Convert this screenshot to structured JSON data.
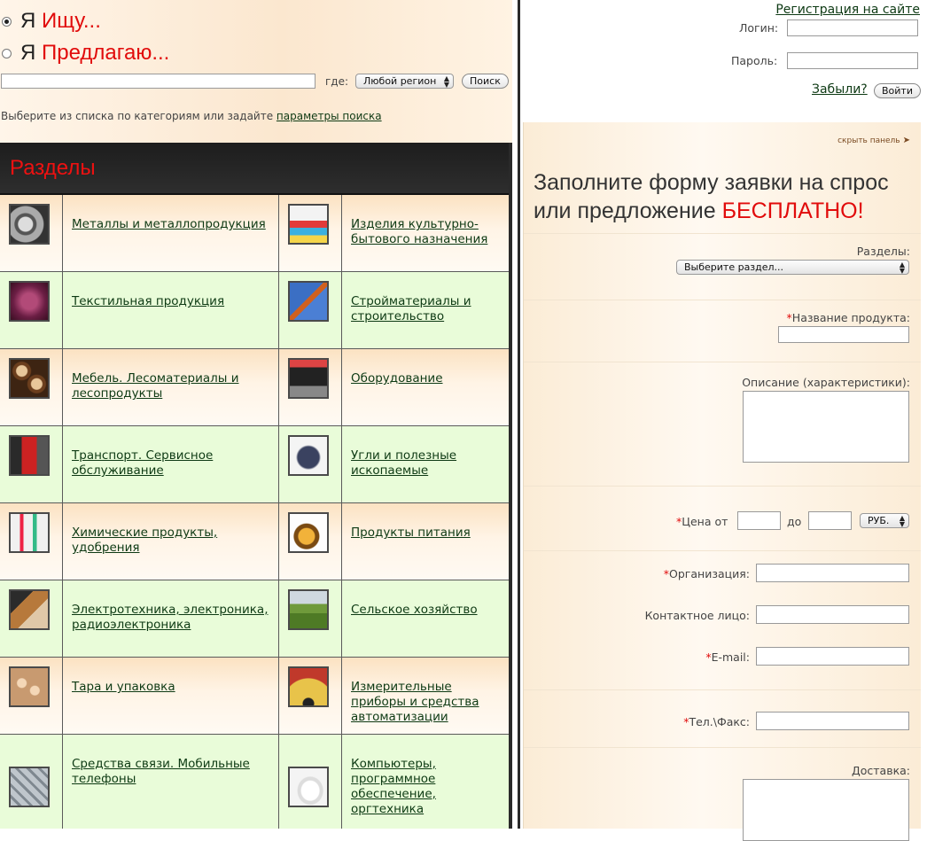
{
  "search": {
    "option_seek_prefix": "Я ",
    "option_seek_red": "Ищу...",
    "option_offer_prefix": "Я ",
    "option_offer_red": "Предлагаю...",
    "selected_option": "seek",
    "query_value": "",
    "where_label": "где:",
    "region_select": "Любой регион",
    "search_button": "Поиск",
    "hint_text": "Выберите из списка по категориям или задайте ",
    "hint_link": "параметры поиска"
  },
  "sections": {
    "title": "Разделы",
    "rows": [
      [
        {
          "label": "Металлы и металлопродукция",
          "icon": "metal-gears-icon"
        },
        {
          "label": "Изделия культурно-бытового назначения",
          "icon": "household-goods-icon"
        }
      ],
      [
        {
          "label": "Текстильная продукция",
          "icon": "textile-fabric-icon"
        },
        {
          "label": "Стройматериалы и строительство",
          "icon": "construction-crane-icon"
        }
      ],
      [
        {
          "label": "Мебель. Лесоматериалы и лесопродукты",
          "icon": "timber-logs-icon"
        },
        {
          "label": "Оборудование",
          "icon": "equipment-machine-icon"
        }
      ],
      [
        {
          "label": "Транспорт. Сервисное обслуживание",
          "icon": "truck-icon"
        },
        {
          "label": "Угли и полезные ископаемые",
          "icon": "coal-mineral-icon"
        }
      ],
      [
        {
          "label": "Химические продукты, удобрения",
          "icon": "chemical-bottles-icon"
        },
        {
          "label": "Продукты питания",
          "icon": "food-fruit-icon"
        }
      ],
      [
        {
          "label": "Электротехника, электроника, радиоэлектроника",
          "icon": "electronics-icon"
        },
        {
          "label": "Сельское хозяйство",
          "icon": "farm-field-icon"
        }
      ],
      [
        {
          "label": "Тара и упаковка",
          "icon": "packaging-box-icon"
        },
        {
          "label": "Измерительные приборы и средства автоматизации",
          "icon": "gauge-meter-icon"
        }
      ],
      [
        {
          "label": "Средства связи. Мобильные телефоны",
          "icon": "phone-keypad-icon"
        },
        {
          "label": "Компьютеры, программное обеспечение, оргтехника",
          "icon": "computer-mouse-icon"
        }
      ]
    ]
  },
  "auth": {
    "register_link": "Регистрация на сайте",
    "login_label": "Логин:",
    "password_label": "Пароль:",
    "forgot_link": "Забыли?",
    "login_button": "Войти"
  },
  "form": {
    "hide_panel": "скрыть панель",
    "title_line1": "Заполните форму заявки на спрос",
    "title_line2": "или предложение ",
    "title_red": "БЕСПЛАТНО",
    "title_end": "!",
    "section_label": "Разделы:",
    "section_select": "Выберите раздел...",
    "product_label": "Название продукта:",
    "description_label": "Описание (характеристики):",
    "price_from_label": "Цена от",
    "price_to_label": "до",
    "currency": "РУБ.",
    "org_label": "Организация:",
    "contact_label": "Контактное лицо:",
    "email_label": "E-mail:",
    "phone_label": "Тел.\\Факс:",
    "delivery_label": "Доставка:",
    "required_mark": "*"
  },
  "colors": {
    "accent_red": "#e10b0b",
    "link_green": "#0e3a14",
    "row_green": "#e9fcd9",
    "header_dark": "#2a2a2a"
  }
}
